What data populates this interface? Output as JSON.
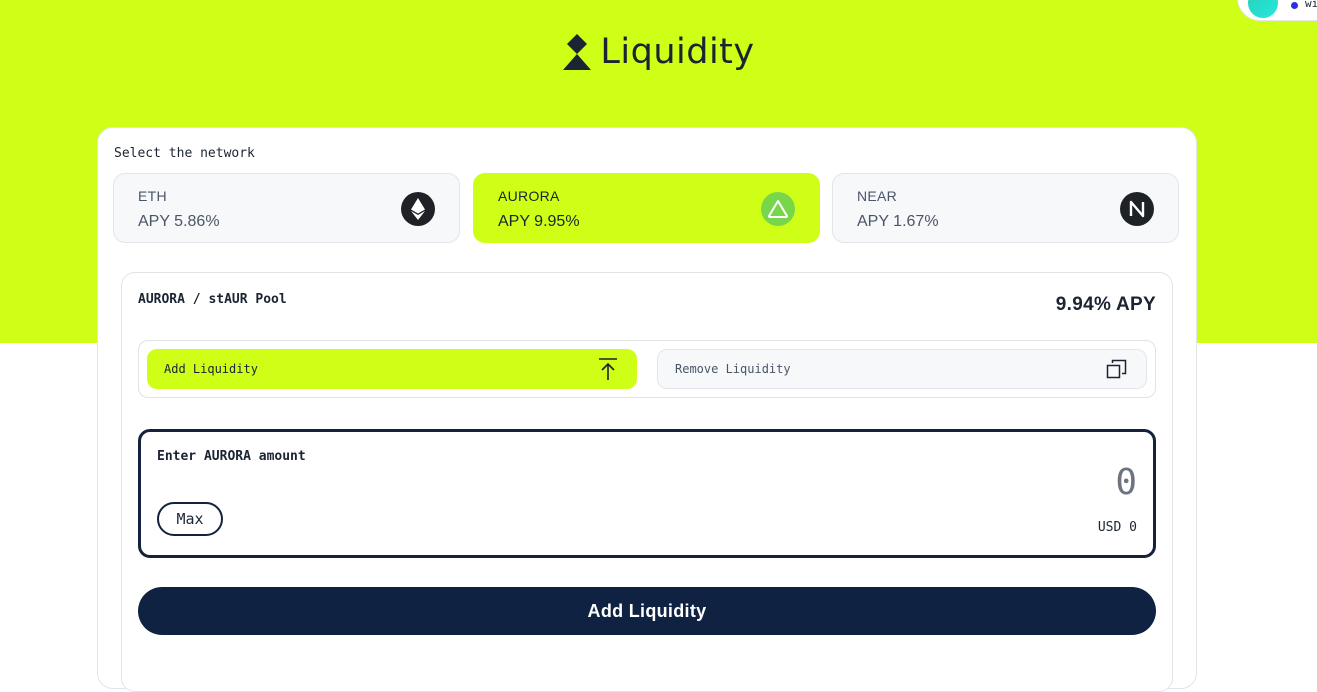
{
  "wallet": {
    "text": "wi"
  },
  "header": {
    "title": "Liquidity"
  },
  "network_select": {
    "label": "Select the network",
    "options": [
      {
        "name": "ETH",
        "apy": "APY 5.86%",
        "icon": "ethereum-icon",
        "selected": false
      },
      {
        "name": "AURORA",
        "apy": "APY 9.95%",
        "icon": "aurora-icon",
        "selected": true
      },
      {
        "name": "NEAR",
        "apy": "APY 1.67%",
        "icon": "near-icon",
        "selected": false
      }
    ]
  },
  "pool": {
    "title": "AURORA / stAUR Pool",
    "apy": "9.94% APY",
    "tabs": [
      {
        "label": "Add Liquidity",
        "icon": "upload-icon",
        "active": true
      },
      {
        "label": "Remove Liquidity",
        "icon": "copy-icon",
        "active": false
      }
    ],
    "amount": {
      "label": "Enter AURORA amount",
      "value": "0",
      "max_label": "Max",
      "usd": "USD 0"
    },
    "submit_label": "Add Liquidity"
  },
  "colors": {
    "accent": "#cfff16",
    "navy": "#0f2242",
    "card_bg": "#f6f8fa"
  }
}
